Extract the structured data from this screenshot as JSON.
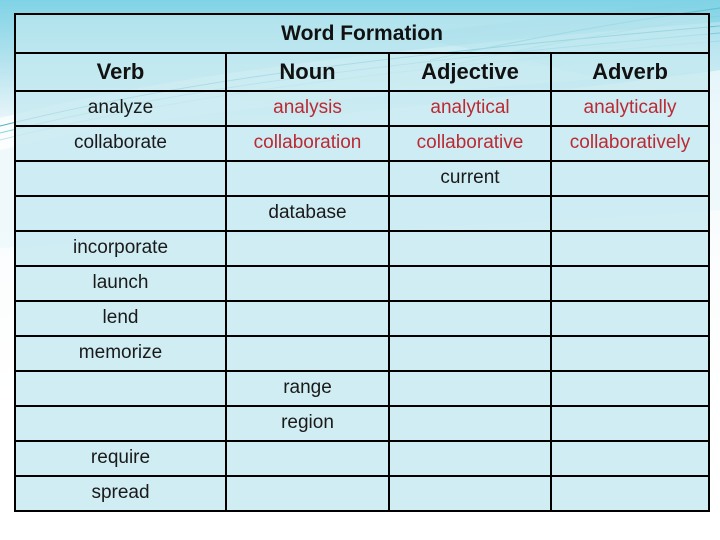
{
  "slide": {
    "title": "Word Formation",
    "background": {
      "top_color": "#8ed8e8",
      "mid_color": "#d9eff5",
      "bottom_color": "#ffffff",
      "swoosh_color": "#3fb6cc",
      "swoosh_light": "#eaf7fb"
    }
  },
  "table": {
    "title": "Word Formation",
    "headers": [
      "Verb",
      "Noun",
      "Adjective",
      "Adverb"
    ],
    "text_colors": {
      "plain": "#1a1a1a",
      "highlight": "#bb2a33"
    },
    "rows": [
      {
        "cells": [
          {
            "text": "analyze",
            "color": "plain"
          },
          {
            "text": "analysis",
            "color": "highlight"
          },
          {
            "text": "analytical",
            "color": "highlight"
          },
          {
            "text": "analytically",
            "color": "highlight"
          }
        ]
      },
      {
        "cells": [
          {
            "text": "collaborate",
            "color": "plain"
          },
          {
            "text": "collaboration",
            "color": "highlight"
          },
          {
            "text": "collaborative",
            "color": "highlight"
          },
          {
            "text": "collaboratively",
            "color": "highlight"
          }
        ]
      },
      {
        "cells": [
          {
            "text": "",
            "color": "plain"
          },
          {
            "text": "",
            "color": "plain"
          },
          {
            "text": "current",
            "color": "plain"
          },
          {
            "text": "",
            "color": "plain"
          }
        ]
      },
      {
        "cells": [
          {
            "text": "",
            "color": "plain"
          },
          {
            "text": "database",
            "color": "plain"
          },
          {
            "text": "",
            "color": "plain"
          },
          {
            "text": "",
            "color": "plain"
          }
        ]
      },
      {
        "cells": [
          {
            "text": "incorporate",
            "color": "plain"
          },
          {
            "text": "",
            "color": "plain"
          },
          {
            "text": "",
            "color": "plain"
          },
          {
            "text": "",
            "color": "plain"
          }
        ]
      },
      {
        "cells": [
          {
            "text": "launch",
            "color": "plain"
          },
          {
            "text": "",
            "color": "plain"
          },
          {
            "text": "",
            "color": "plain"
          },
          {
            "text": "",
            "color": "plain"
          }
        ]
      },
      {
        "cells": [
          {
            "text": "lend",
            "color": "plain"
          },
          {
            "text": "",
            "color": "plain"
          },
          {
            "text": "",
            "color": "plain"
          },
          {
            "text": "",
            "color": "plain"
          }
        ]
      },
      {
        "cells": [
          {
            "text": "memorize",
            "color": "plain"
          },
          {
            "text": "",
            "color": "plain"
          },
          {
            "text": "",
            "color": "plain"
          },
          {
            "text": "",
            "color": "plain"
          }
        ]
      },
      {
        "cells": [
          {
            "text": "",
            "color": "plain"
          },
          {
            "text": "range",
            "color": "plain"
          },
          {
            "text": "",
            "color": "plain"
          },
          {
            "text": "",
            "color": "plain"
          }
        ]
      },
      {
        "cells": [
          {
            "text": "",
            "color": "plain"
          },
          {
            "text": "region",
            "color": "plain"
          },
          {
            "text": "",
            "color": "plain"
          },
          {
            "text": "",
            "color": "plain"
          }
        ]
      },
      {
        "cells": [
          {
            "text": "require",
            "color": "plain"
          },
          {
            "text": "",
            "color": "plain"
          },
          {
            "text": "",
            "color": "plain"
          },
          {
            "text": "",
            "color": "plain"
          }
        ]
      },
      {
        "cells": [
          {
            "text": "spread",
            "color": "plain"
          },
          {
            "text": "",
            "color": "plain"
          },
          {
            "text": "",
            "color": "plain"
          },
          {
            "text": "",
            "color": "plain"
          }
        ]
      }
    ]
  }
}
